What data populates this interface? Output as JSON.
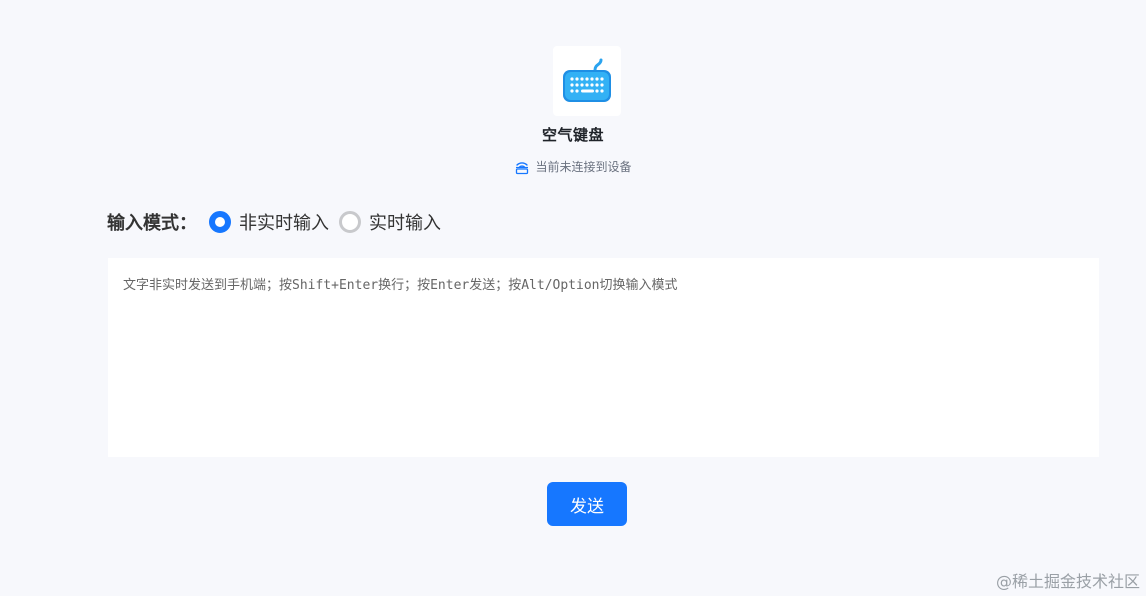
{
  "app": {
    "title": "空气键盘",
    "icon": "keyboard-icon",
    "accent_color": "#1677ff"
  },
  "status": {
    "icon": "disconnected-device-icon",
    "text": "当前未连接到设备"
  },
  "input_mode": {
    "label": "输入模式：",
    "options": [
      {
        "label": "非实时输入",
        "selected": true
      },
      {
        "label": "实时输入",
        "selected": false
      }
    ]
  },
  "editor": {
    "value": "",
    "placeholder": "文字非实时发送到手机端；按Shift+Enter换行；按Enter发送；按Alt/Option切换输入模式"
  },
  "send_button": {
    "label": "发送"
  },
  "watermark": {
    "text": "@稀土掘金技术社区"
  }
}
